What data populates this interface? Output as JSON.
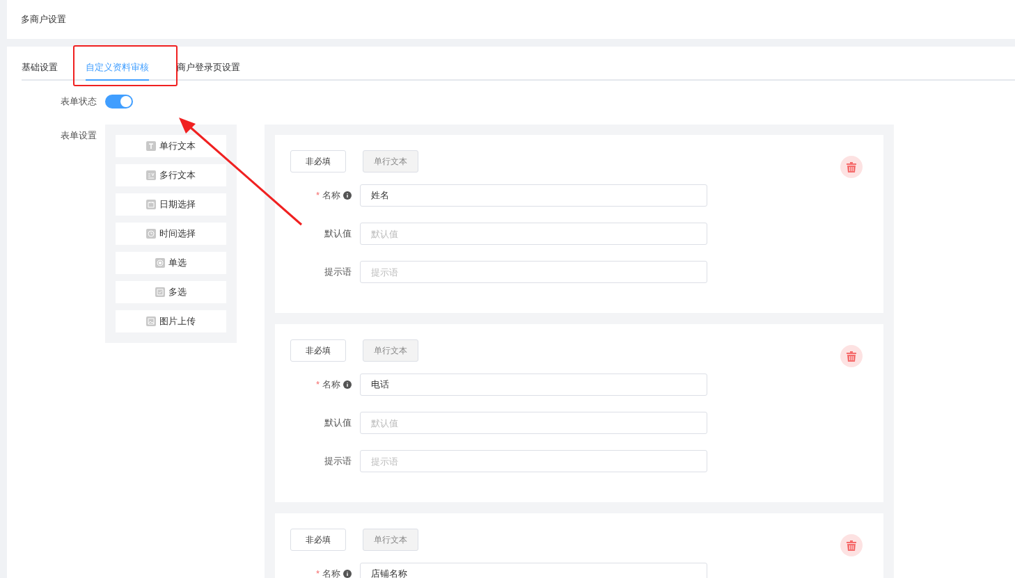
{
  "header": {
    "title": "多商户设置"
  },
  "tabs": [
    {
      "label": "基础设置",
      "selected": false
    },
    {
      "label": "自定义资料审核",
      "selected": true
    },
    {
      "label": "商户登录页设置",
      "selected": false
    }
  ],
  "form_status": {
    "label": "表单状态",
    "on": true
  },
  "form_settings": {
    "label": "表单设置"
  },
  "palette": [
    {
      "kind": "text",
      "label": "单行文本"
    },
    {
      "kind": "textarea",
      "label": "多行文本"
    },
    {
      "kind": "date",
      "label": "日期选择"
    },
    {
      "kind": "time",
      "label": "时间选择"
    },
    {
      "kind": "radio",
      "label": "单选"
    },
    {
      "kind": "checkbox",
      "label": "多选"
    },
    {
      "kind": "image",
      "label": "图片上传"
    }
  ],
  "cards": [
    {
      "required_toggle": "非必填",
      "type": "单行文本",
      "fields": [
        {
          "marker": "*",
          "label": "名称",
          "info": true,
          "value": "姓名"
        },
        {
          "label": "默认值",
          "info": false,
          "placeholder": "默认值"
        },
        {
          "label": "提示语",
          "info": false,
          "placeholder": "提示语"
        }
      ]
    },
    {
      "required_toggle": "非必填",
      "type": "单行文本",
      "fields": [
        {
          "marker": "*",
          "label": "名称",
          "info": true,
          "value": "电话"
        },
        {
          "label": "默认值",
          "info": false,
          "placeholder": "默认值"
        },
        {
          "label": "提示语",
          "info": false,
          "placeholder": "提示语"
        }
      ]
    },
    {
      "required_toggle": "非必填",
      "type": "单行文本",
      "fields": [
        {
          "marker": "*",
          "label": "名称",
          "info": true,
          "value": "店铺名称"
        }
      ]
    }
  ]
}
